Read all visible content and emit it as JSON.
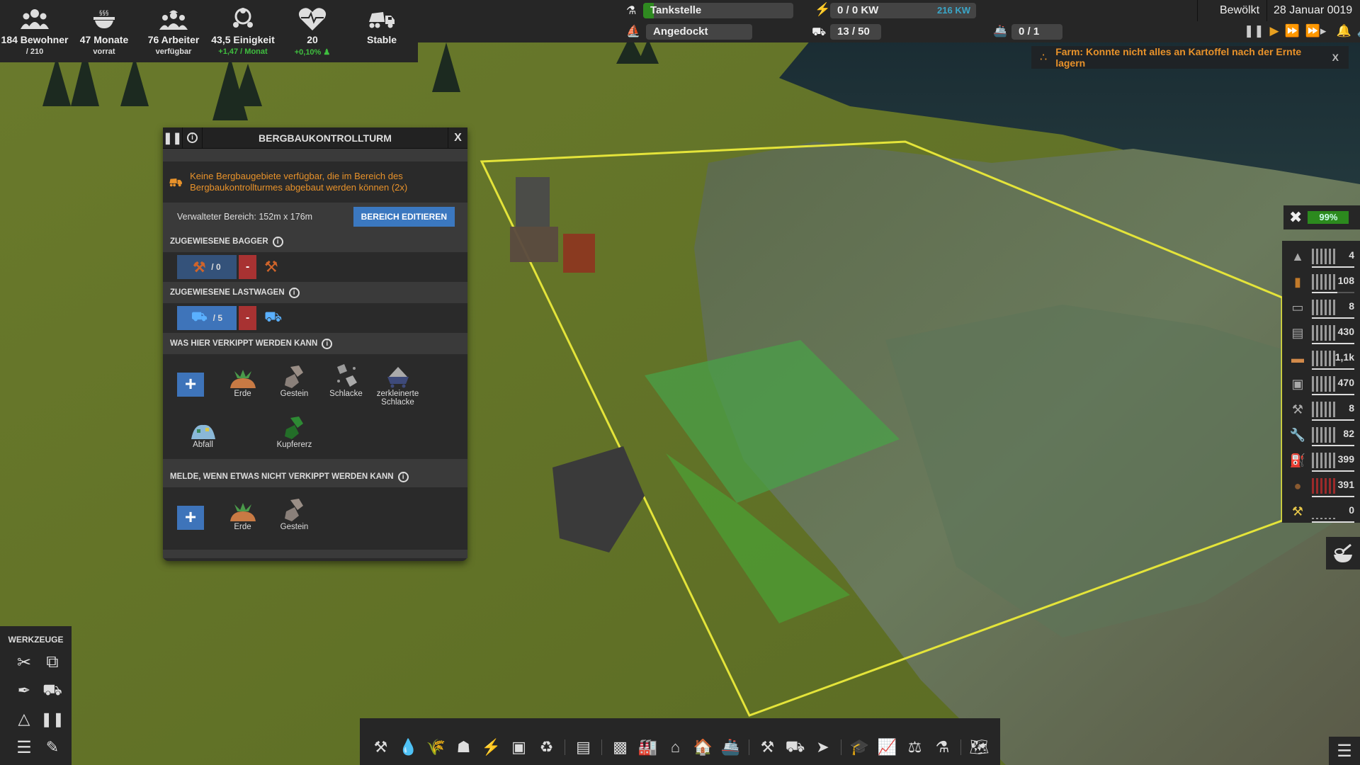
{
  "stats": [
    {
      "icon": "population-icon",
      "main": "184 Bewohner",
      "sub": "/ 210",
      "sub_green": false
    },
    {
      "icon": "food-bowl-icon",
      "main": "47 Monate",
      "sub": "vorrat",
      "sub_green": false
    },
    {
      "icon": "workers-icon",
      "main": "76 Arbeiter",
      "sub": "verfügbar",
      "sub_green": false
    },
    {
      "icon": "unity-icon",
      "main": "43,5 Einigkeit",
      "sub": "+1,47 / Monat",
      "sub_green": true
    },
    {
      "icon": "health-heart-icon",
      "main": "20",
      "sub": "+0,10%",
      "sub_green": true
    },
    {
      "icon": "dump-truck-icon",
      "main": "Stable",
      "sub": "",
      "sub_green": false
    }
  ],
  "research": {
    "label": "Tankstelle",
    "progress": 0.07
  },
  "ship_status": {
    "label": "Angedockt"
  },
  "power": {
    "label": "0 / 0 KW",
    "extra": "216 KW"
  },
  "trucks": {
    "label": "13 / 50"
  },
  "ships": {
    "label": "0 / 1"
  },
  "weather": "Bewölkt",
  "date": "28 Januar 0019",
  "colors": {
    "accent_orange": "#e8922a",
    "accent_blue": "#3e74ba",
    "green": "#2f8a20",
    "warn_red": "#a83232",
    "power_extra": "#3aa6c8"
  },
  "notification": {
    "text": "Farm: Konnte nicht alles an Kartoffel nach der Ernte lagern",
    "close": "X"
  },
  "panel": {
    "title": "BERGBAUKONTROLLTURM",
    "close": "X",
    "warning": "Keine Bergbaugebiete verfügbar, die im Bereich des Bergbaukontrollturmes abgebaut werden können (2x)",
    "area_label": "Verwalteter Bereich: 152m x 176m",
    "edit_button": "BEREICH EDITIEREN",
    "excavators": {
      "header": "ZUGEWIESENE BAGGER",
      "count": "/ 0",
      "minus": "-"
    },
    "trucks": {
      "header": "ZUGEWIESENE LASTWAGEN",
      "count": "/ 5",
      "minus": "-"
    },
    "dump_header": "WAS HIER VERKIPPT WERDEN KANN",
    "dump_items": [
      "Erde",
      "Gestein",
      "Schlacke",
      "zerkleinerte Schlacke",
      "Abfall",
      "Kupfererz"
    ],
    "notify_header": "MELDE, WENN ETWAS NICHT VERKIPPT WERDEN KANN",
    "notify_items": [
      "Erde",
      "Gestein"
    ],
    "add": "+"
  },
  "maintenance": {
    "label": "99%"
  },
  "resources": [
    {
      "icon": "iron-ore-icon",
      "value": "4",
      "level": 1.0,
      "alert": false
    },
    {
      "icon": "wood-log-icon",
      "value": "108",
      "level": 0.6,
      "alert": false
    },
    {
      "icon": "iron-plate-icon",
      "value": "8",
      "level": 1.0,
      "alert": false
    },
    {
      "icon": "steel-barrel-icon",
      "value": "430",
      "level": 1.0,
      "alert": false
    },
    {
      "icon": "wood-plank-icon",
      "value": "1,1k",
      "level": 1.0,
      "alert": false
    },
    {
      "icon": "cement-sack-icon",
      "value": "470",
      "level": 1.0,
      "alert": false
    },
    {
      "icon": "construction-parts-icon",
      "value": "8",
      "level": 1.0,
      "alert": false
    },
    {
      "icon": "mechanical-parts-icon",
      "value": "82",
      "level": 1.0,
      "alert": false
    },
    {
      "icon": "diesel-canister-icon",
      "value": "399",
      "level": 1.0,
      "alert": false
    },
    {
      "icon": "potato-icon",
      "value": "391",
      "level": 1.0,
      "alert": true
    },
    {
      "icon": "construction-parts-2-icon",
      "value": "0",
      "level": 1.0,
      "alert": false
    }
  ],
  "tools": {
    "header": "WERKZEUGE"
  }
}
